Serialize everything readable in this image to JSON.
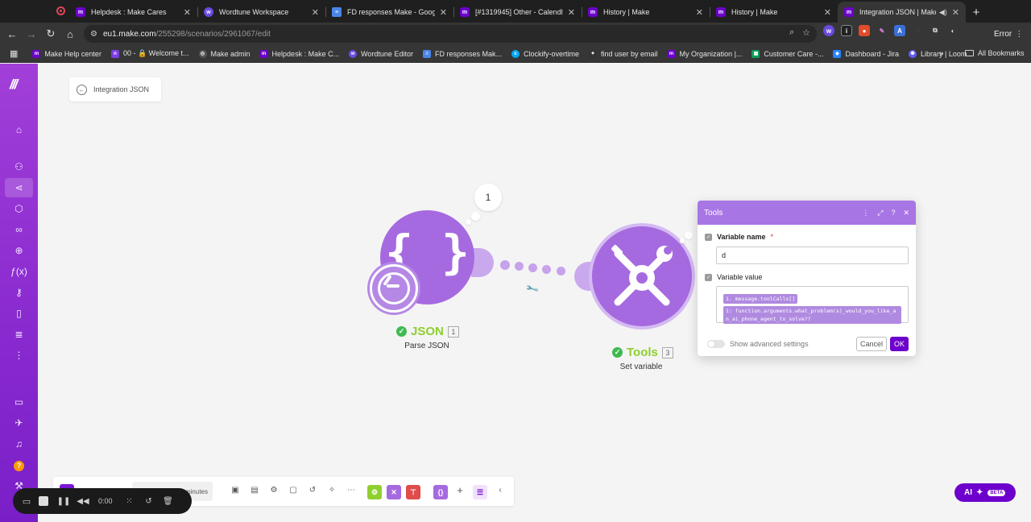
{
  "browser": {
    "tabs": [
      {
        "title": "Helpdesk : Make Cares",
        "favicon": "make-icon",
        "active": false
      },
      {
        "title": "Wordtune Workspace",
        "favicon": "wordtune-icon",
        "active": false
      },
      {
        "title": "FD responses Make - Google",
        "favicon": "docs-icon",
        "active": false
      },
      {
        "title": "[#1319945] Other - Calendly",
        "favicon": "make-icon",
        "active": false
      },
      {
        "title": "History | Make",
        "favicon": "make-icon",
        "active": false
      },
      {
        "title": "History | Make",
        "favicon": "make-icon",
        "active": false
      },
      {
        "title": "Integration JSON | Make",
        "favicon": "make-icon",
        "active": true
      }
    ],
    "url_host": "eu1.make.com",
    "url_path": "/255298/scenarios/2961067/edit",
    "error_label": "Error",
    "bookmarks": [
      "Make Help center",
      "00 - 🔒 Welcome t...",
      "Make admin",
      "Helpdesk : Make C...",
      "Wordtune Editor",
      "FD responses Mak...",
      "Clockify-overtime",
      "find user by email",
      "My Organization |...",
      "Customer Care -...",
      "Dashboard - Jira",
      "Library | Loom"
    ],
    "all_bookmarks": "All Bookmarks"
  },
  "app": {
    "back_label": "Integration JSON",
    "modules": {
      "json": {
        "name": "JSON",
        "number": "1",
        "subtitle": "Parse JSON",
        "bubble_count": "1"
      },
      "tools": {
        "name": "Tools",
        "number": "3",
        "subtitle": "Set variable"
      }
    },
    "panel": {
      "title": "Tools",
      "variable_name_label": "Variable name",
      "required_mark": "*",
      "variable_name_value": "d",
      "variable_value_label": "Variable value",
      "variable_value_token1": "1. message.toolCalls[]",
      "variable_value_token2": "1: function.arguments.what_problem(s)_would_you_like_an_ai_phone_agent_to_solve??",
      "advanced_label": "Show advanced settings",
      "cancel_label": "Cancel",
      "ok_label": "OK"
    },
    "bottom_bar": {
      "minutes_label": "minutes"
    },
    "recorder": {
      "time": "0:00"
    },
    "ai_button": {
      "label": "AI",
      "badge": "BETA"
    }
  }
}
